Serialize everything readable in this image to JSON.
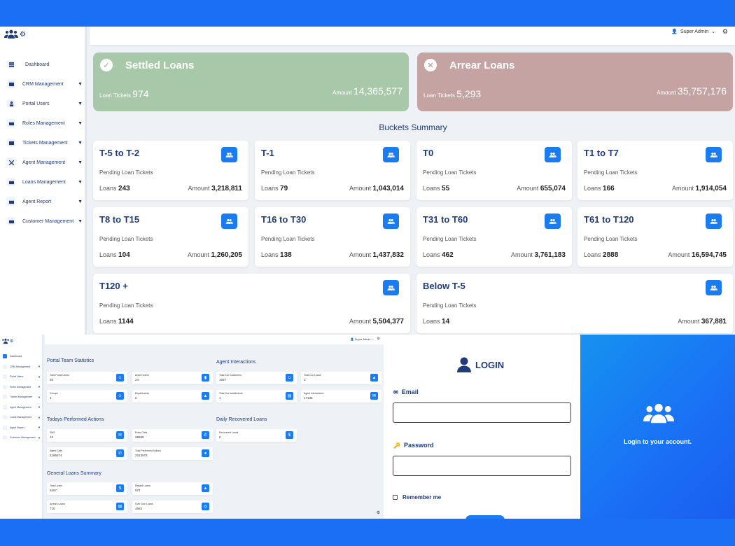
{
  "dashboard": {
    "user": "Super Admin",
    "sidebar": [
      "Dashboard",
      "CRM Management",
      "Portal Users",
      "Roles Management",
      "Tickets Management",
      "Agent Management",
      "Loans Management",
      "Agent Report",
      "Customer Management"
    ],
    "settled": {
      "title": "Settled Loans",
      "tickets_label": "Loan Tickets",
      "tickets": "974",
      "amount_label": "Amount",
      "amount": "14,365,577"
    },
    "arrear": {
      "title": "Arrear Loans",
      "tickets_label": "Loan Tickets",
      "tickets": "5,293",
      "amount_label": "Amount",
      "amount": "35,757,176"
    },
    "buckets_title": "Buckets Summary",
    "pending_label": "Pending Loan Tickets",
    "loans_label": "Loans",
    "amount_label": "Amount",
    "buckets": [
      {
        "title": "T-5 to T-2",
        "loans": "243",
        "amount": "3,218,811"
      },
      {
        "title": "T-1",
        "loans": "79",
        "amount": "1,043,014"
      },
      {
        "title": "T0",
        "loans": "55",
        "amount": "655,074"
      },
      {
        "title": "T1 to T7",
        "loans": "166",
        "amount": "1,914,054"
      },
      {
        "title": "T8 to T15",
        "loans": "104",
        "amount": "1,260,205"
      },
      {
        "title": "T16 to T30",
        "loans": "138",
        "amount": "1,437,832"
      },
      {
        "title": "T31 to T60",
        "loans": "462",
        "amount": "3,761,183"
      },
      {
        "title": "T61 to T120",
        "loans": "2888",
        "amount": "16,594,745"
      },
      {
        "title": "T120 +",
        "loans": "1144",
        "amount": "5,504,377"
      },
      {
        "title": "Below T-5",
        "loans": "14",
        "amount": "367,881"
      }
    ]
  },
  "mini_dashboard": {
    "user": "Super Admin",
    "sidebar": [
      "Dashboard",
      "CRM Management",
      "Portal Users",
      "Roles Management",
      "Tickets Management",
      "Agent Management",
      "Loans Management",
      "Agent Report",
      "Customer Management"
    ],
    "sections": {
      "portal_team": "Portal Team Statistics",
      "agent_interactions": "Agent Interactions",
      "todays_actions": "Todays Performed Actions",
      "daily_recovered": "Daily Recovered Loans",
      "general_loans": "General Loans Summary"
    },
    "stats": [
      {
        "label": "Total Portal Users",
        "value": "36"
      },
      {
        "label": "Active Users",
        "value": "24"
      },
      {
        "label": "Groups",
        "value": "4"
      },
      {
        "label": "Departments",
        "value": "6"
      },
      {
        "label": "Total Cur Customers",
        "value": "1937"
      },
      {
        "label": "Total Cur Loans",
        "value": "3"
      },
      {
        "label": "Total Cur Installments",
        "value": "1"
      },
      {
        "label": "Agent Interactions",
        "value": "17138"
      },
      {
        "label": "SMS",
        "value": "13"
      },
      {
        "label": "Robo Calls",
        "value": "28589"
      },
      {
        "label": "Agent Calls",
        "value": "2185374"
      },
      {
        "label": "Total Performed Actions",
        "value": "2213976"
      },
      {
        "label": "Recovered Loans",
        "value": "0"
      },
      {
        "label": "Total Loans",
        "value": "6267"
      },
      {
        "label": "Repaid Loans",
        "value": "974"
      },
      {
        "label": "Arrears Loans",
        "value": "710"
      },
      {
        "label": "Over Due Loans",
        "value": "4583"
      }
    ]
  },
  "login": {
    "title": "LOGIN",
    "email_label": "Email",
    "password_label": "Password",
    "remember_label": "Remember me",
    "promo_text": "Login to your account."
  }
}
